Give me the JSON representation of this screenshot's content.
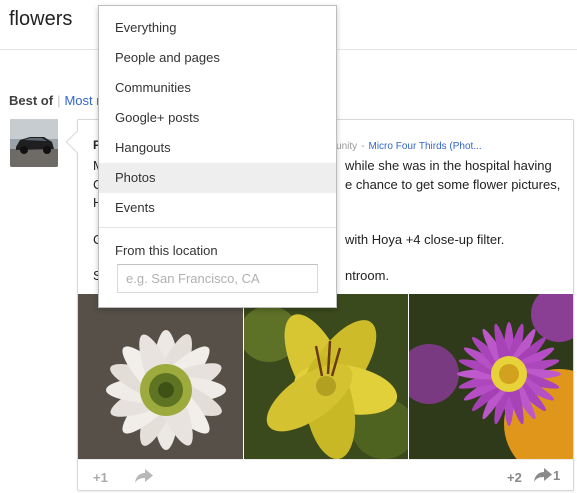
{
  "search": {
    "query": "flowers"
  },
  "filters": {
    "best_of": "Best of",
    "separator": "|",
    "most_recent": "Most r"
  },
  "dropdown": {
    "items": [
      "Everything",
      "People and pages",
      "Communities",
      "Google+ posts",
      "Hangouts",
      "Photos",
      "Events"
    ],
    "selected": "Photos",
    "location_label": "From this location",
    "location_placeholder": "e.g. San Francisco, CA"
  },
  "post": {
    "author_initial": "P",
    "community_label": "...mmunity",
    "meta_dash": "-",
    "community_link": "Micro Four Thirds (Phot...",
    "line_prefixes": [
      "M",
      "C",
      "H",
      "",
      "C",
      "",
      "S"
    ],
    "line_suffixes": [
      "while she was in the hospital having",
      "e chance to get some flower pictures,",
      "",
      "",
      "with Hoya +4 close-up filter.",
      "",
      "ntroom."
    ]
  },
  "actions": {
    "plus_one": "+1",
    "plus_count": "+2",
    "share_count": "1"
  },
  "icons": {
    "share": "share-arrow-icon"
  }
}
